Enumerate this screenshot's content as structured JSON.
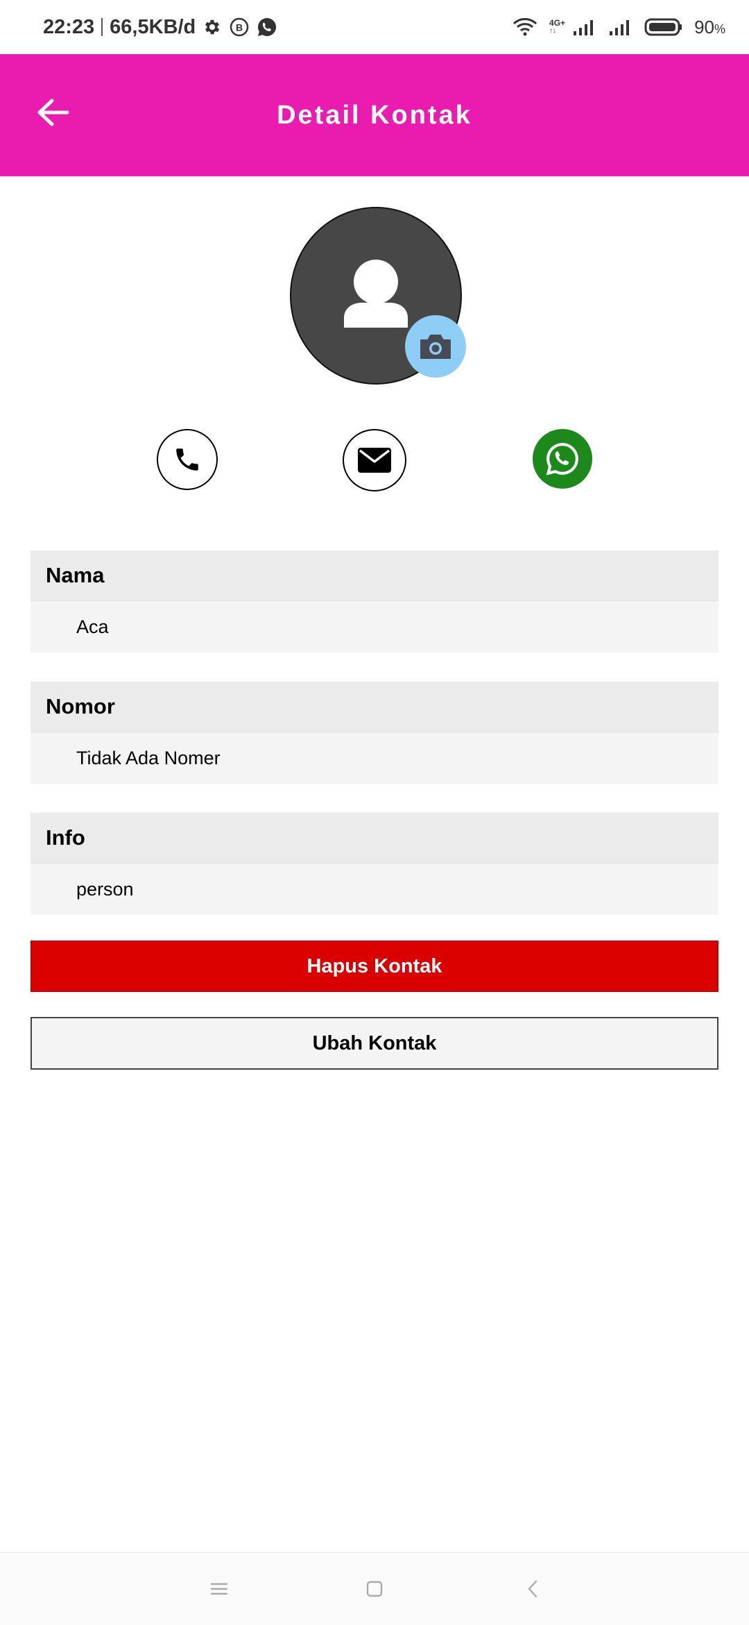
{
  "status_bar": {
    "time": "22:23",
    "net_speed": "66,5KB/d",
    "network_type": "4G+",
    "battery_percent": "90",
    "battery_unit": "%",
    "icons": [
      "settings-icon",
      "b-badge-icon",
      "whatsapp-notification-icon",
      "wifi-icon",
      "signal-icon",
      "battery-icon"
    ]
  },
  "app_bar": {
    "title": "Detail Kontak",
    "back_icon": "arrow-left-icon",
    "color": "#ea1cb0"
  },
  "avatar": {
    "icon": "person-icon",
    "camera_icon": "camera-icon",
    "background": "#474747",
    "camera_background": "#8ecdf6"
  },
  "actions": [
    {
      "icon": "phone-icon"
    },
    {
      "icon": "email-icon"
    },
    {
      "icon": "whatsapp-icon",
      "color": "#1b8a1b"
    }
  ],
  "fields": {
    "nama": {
      "label": "Nama",
      "value": "Aca"
    },
    "nomor": {
      "label": "Nomor",
      "value": "Tidak Ada Nomer"
    },
    "info": {
      "label": "Info",
      "value": "person"
    }
  },
  "buttons": {
    "delete_label": "Hapus Kontak",
    "delete_color": "#db0000",
    "edit_label": "Ubah Kontak"
  },
  "nav_bar": {
    "icons": [
      "menu-icon",
      "home-icon",
      "back-icon"
    ]
  }
}
